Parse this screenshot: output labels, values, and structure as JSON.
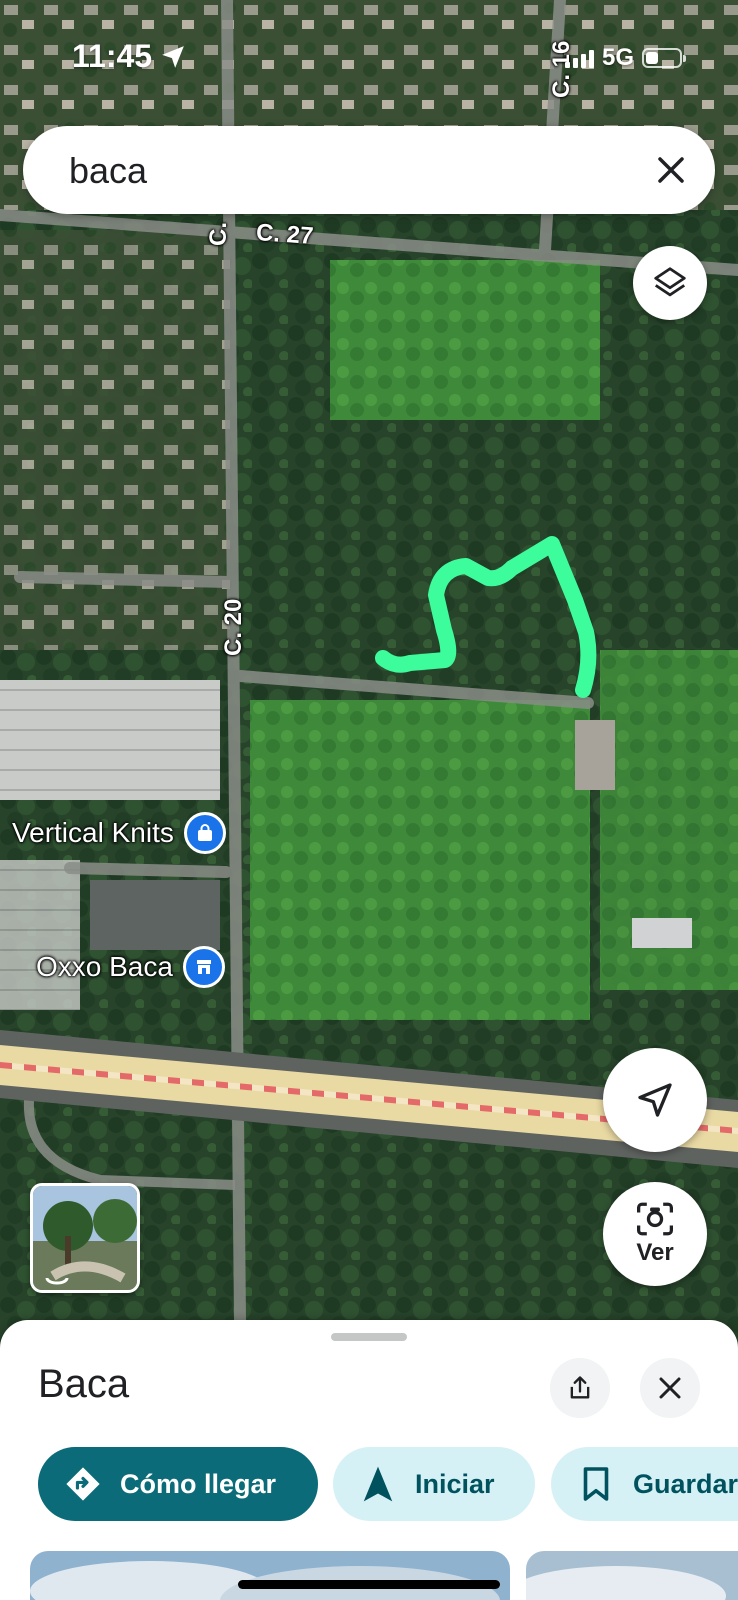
{
  "status": {
    "time": "11:45",
    "network": "5G"
  },
  "search": {
    "query": "baca"
  },
  "map": {
    "road_labels": [
      "C. 16",
      "C.",
      "C. 27",
      "C. 20"
    ],
    "pois": [
      "Vertical Knits",
      "Oxxo Baca"
    ],
    "drawn_path_color": "#3dfc9b"
  },
  "controls": {
    "view_label": "Ver"
  },
  "sheet": {
    "title": "Baca",
    "actions": {
      "directions": "Cómo llegar",
      "start": "Iniciar",
      "save": "Guardar"
    }
  },
  "colors": {
    "accent": "#0b6b78",
    "chip_secondary": "#d6f1f5",
    "poi_blue": "#1a73e8"
  }
}
